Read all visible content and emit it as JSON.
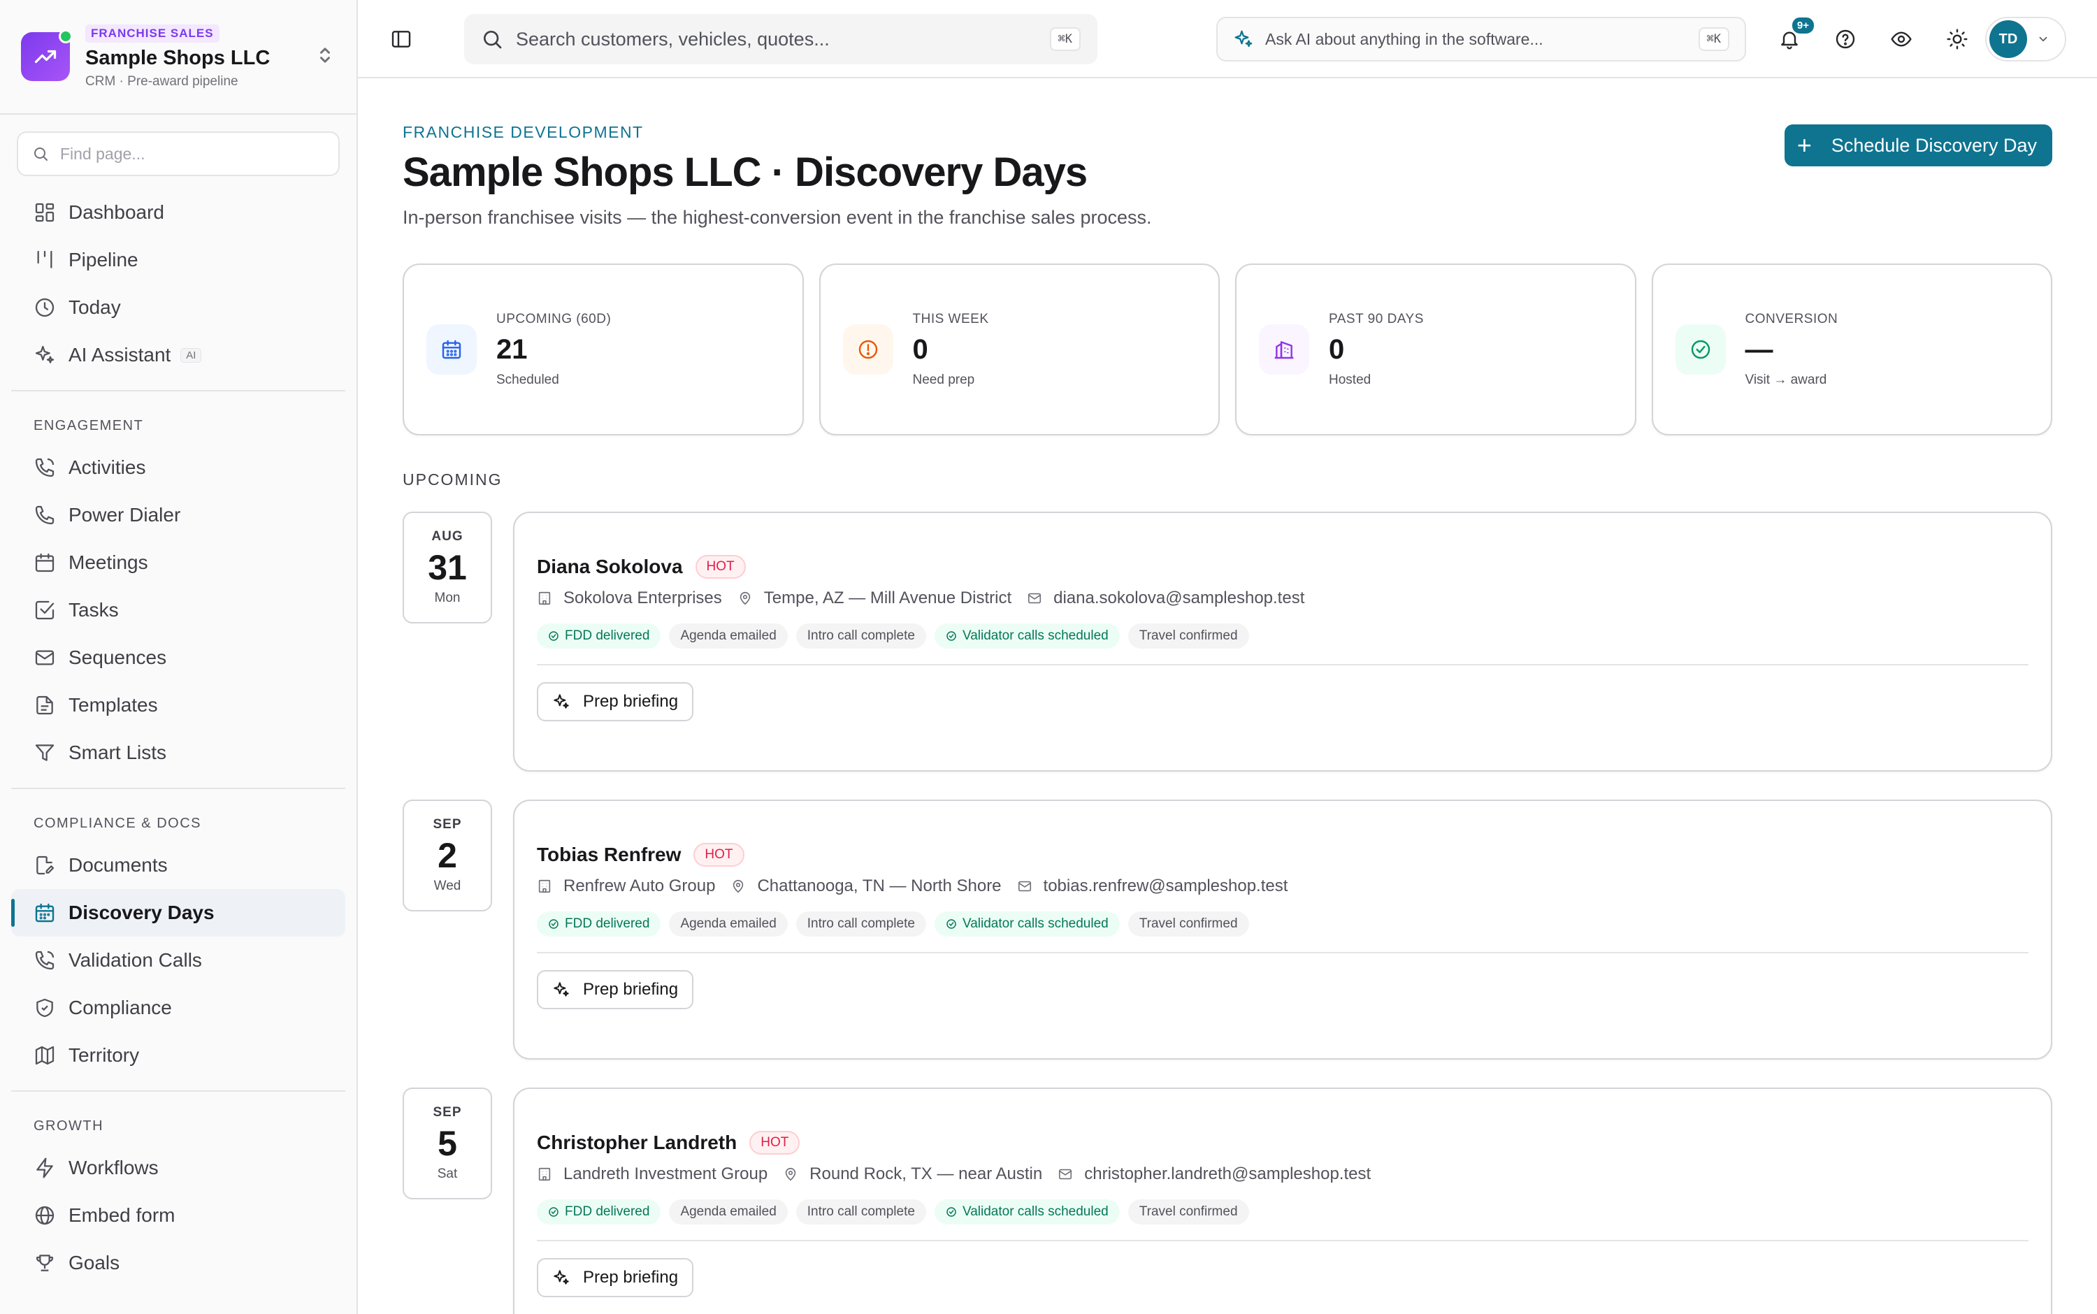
{
  "brand": {
    "tag": "FRANCHISE SALES",
    "name": "Sample Shops LLC",
    "subtitle": "CRM · Pre-award pipeline"
  },
  "sidebar": {
    "search_placeholder": "Find page...",
    "main_items": [
      {
        "label": "Dashboard",
        "icon": "dashboard-icon"
      },
      {
        "label": "Pipeline",
        "icon": "pipeline-icon"
      },
      {
        "label": "Today",
        "icon": "clock-icon"
      },
      {
        "label": "AI Assistant",
        "icon": "sparkles-icon",
        "badge": "AI"
      }
    ],
    "sections": [
      {
        "label": "ENGAGEMENT",
        "items": [
          {
            "label": "Activities",
            "icon": "phone-icon"
          },
          {
            "label": "Power Dialer",
            "icon": "phone-icon"
          },
          {
            "label": "Meetings",
            "icon": "calendar-icon"
          },
          {
            "label": "Tasks",
            "icon": "checkbox-icon"
          },
          {
            "label": "Sequences",
            "icon": "mail-icon"
          },
          {
            "label": "Templates",
            "icon": "file-icon"
          },
          {
            "label": "Smart Lists",
            "icon": "filter-icon"
          }
        ]
      },
      {
        "label": "COMPLIANCE & DOCS",
        "items": [
          {
            "label": "Documents",
            "icon": "file-edit-icon"
          },
          {
            "label": "Discovery Days",
            "icon": "calendar-icon",
            "active": true
          },
          {
            "label": "Validation Calls",
            "icon": "phone-icon"
          },
          {
            "label": "Compliance",
            "icon": "shield-icon"
          },
          {
            "label": "Territory",
            "icon": "map-icon"
          }
        ]
      },
      {
        "label": "GROWTH",
        "items": [
          {
            "label": "Workflows",
            "icon": "bolt-icon"
          },
          {
            "label": "Embed form",
            "icon": "globe-icon"
          },
          {
            "label": "Goals",
            "icon": "trophy-icon"
          }
        ]
      }
    ]
  },
  "topbar": {
    "search_placeholder": "Search customers, vehicles, quotes...",
    "search_kbd": "⌘K",
    "ask_ai_placeholder": "Ask AI about anything in the software...",
    "ask_ai_kbd": "⌘K",
    "notifications_badge": "9+",
    "avatar_initials": "TD"
  },
  "page": {
    "eyebrow": "FRANCHISE DEVELOPMENT",
    "title": "Sample Shops LLC · Discovery Days",
    "description": "In-person franchisee visits — the highest-conversion event in the franchise sales process.",
    "primary_button": "Schedule Discovery Day"
  },
  "stats": [
    {
      "label": "UPCOMING (60D)",
      "value": "21",
      "sub": "Scheduled",
      "icon": "calendar-icon",
      "color": "#2563eb",
      "bg": "#eff6ff"
    },
    {
      "label": "THIS WEEK",
      "value": "0",
      "sub": "Need prep",
      "icon": "alert-circle-icon",
      "color": "#ea580c",
      "bg": "#fff7ed"
    },
    {
      "label": "PAST 90 DAYS",
      "value": "0",
      "sub": "Hosted",
      "icon": "building-icon",
      "color": "#9333ea",
      "bg": "#faf5ff"
    },
    {
      "label": "CONVERSION",
      "value": "—",
      "sub": "Visit → award",
      "icon": "check-circle-icon",
      "color": "#059669",
      "bg": "#ecfdf5"
    }
  ],
  "upcoming_label": "UPCOMING",
  "events": [
    {
      "month": "AUG",
      "day": "31",
      "weekday": "Mon",
      "name": "Diana Sokolova",
      "badge": "HOT",
      "company": "Sokolova Enterprises",
      "location": "Tempe, AZ — Mill Avenue District",
      "email": "diana.sokolova@sampleshop.test",
      "chips": [
        {
          "label": "FDD delivered",
          "done": true
        },
        {
          "label": "Agenda emailed",
          "done": false
        },
        {
          "label": "Intro call complete",
          "done": false
        },
        {
          "label": "Validator calls scheduled",
          "done": true
        },
        {
          "label": "Travel confirmed",
          "done": false
        }
      ],
      "action": "Prep briefing"
    },
    {
      "month": "SEP",
      "day": "2",
      "weekday": "Wed",
      "name": "Tobias Renfrew",
      "badge": "HOT",
      "company": "Renfrew Auto Group",
      "location": "Chattanooga, TN — North Shore",
      "email": "tobias.renfrew@sampleshop.test",
      "chips": [
        {
          "label": "FDD delivered",
          "done": true
        },
        {
          "label": "Agenda emailed",
          "done": false
        },
        {
          "label": "Intro call complete",
          "done": false
        },
        {
          "label": "Validator calls scheduled",
          "done": true
        },
        {
          "label": "Travel confirmed",
          "done": false
        }
      ],
      "action": "Prep briefing"
    },
    {
      "month": "SEP",
      "day": "5",
      "weekday": "Sat",
      "name": "Christopher Landreth",
      "badge": "HOT",
      "company": "Landreth Investment Group",
      "location": "Round Rock, TX — near Austin",
      "email": "christopher.landreth@sampleshop.test",
      "chips": [
        {
          "label": "FDD delivered",
          "done": true
        },
        {
          "label": "Agenda emailed",
          "done": false
        },
        {
          "label": "Intro call complete",
          "done": false
        },
        {
          "label": "Validator calls scheduled",
          "done": true
        },
        {
          "label": "Travel confirmed",
          "done": false
        }
      ],
      "action": "Prep briefing"
    }
  ]
}
